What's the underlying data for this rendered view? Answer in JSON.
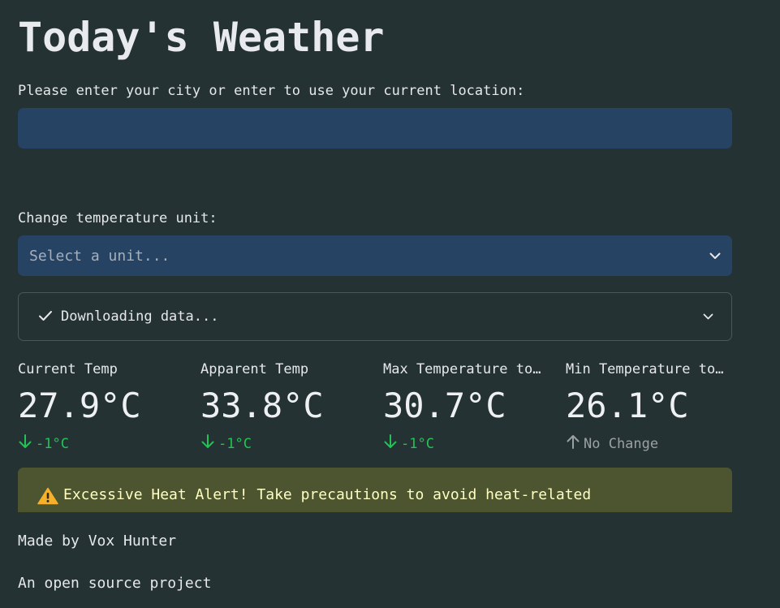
{
  "page": {
    "title": "Today's Weather"
  },
  "location": {
    "label": "Please enter your city or enter to use your current location:",
    "value": "",
    "placeholder": ""
  },
  "unit": {
    "label": "Change temperature unit:",
    "placeholder": "Select a unit...",
    "icon": "chevron-down-icon"
  },
  "status": {
    "text": "Downloading data...",
    "icon": "check-icon",
    "expand_icon": "chevron-down-icon"
  },
  "metrics": [
    {
      "label": "Current Temp",
      "value": "27.9°C",
      "delta": "-1°C",
      "direction": "down",
      "color": "#21c354"
    },
    {
      "label": "Apparent Temp",
      "value": "33.8°C",
      "delta": "-1°C",
      "direction": "down",
      "color": "#21c354"
    },
    {
      "label": "Max Temperature to…",
      "value": "30.7°C",
      "delta": "-1°C",
      "direction": "down",
      "color": "#21c354"
    },
    {
      "label": "Min Temperature to…",
      "value": "26.1°C",
      "delta": "No Change",
      "direction": "none",
      "color": "#9aa1a6"
    }
  ],
  "alert": {
    "icon": "warning-icon",
    "text": "Excessive Heat Alert! Take precautions to avoid heat-related",
    "background": "#4c5530",
    "text_color": "#ffffc2"
  },
  "footer": {
    "credit": "Made by Vox Hunter",
    "project": "An open source project"
  },
  "colors": {
    "background": "#243233",
    "input_background": "#264364",
    "positive": "#21c354",
    "neutral": "#9aa1a6"
  }
}
